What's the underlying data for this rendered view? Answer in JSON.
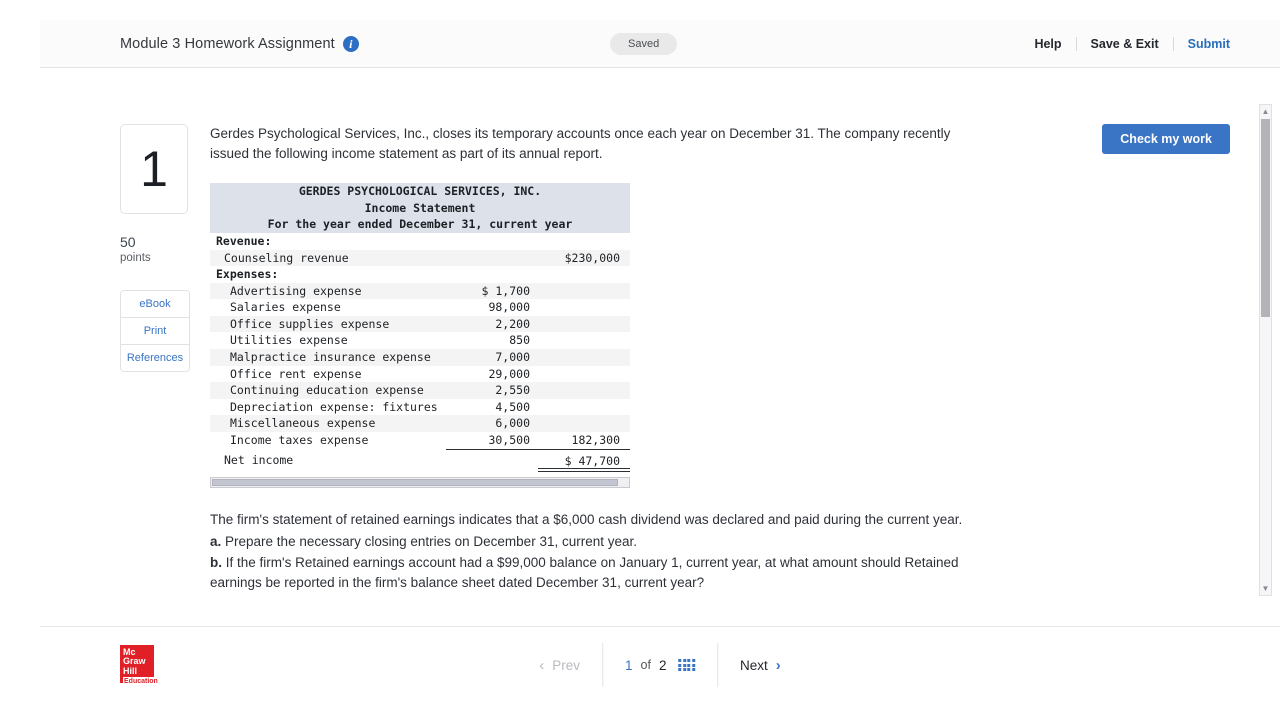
{
  "header": {
    "title": "Module 3 Homework Assignment",
    "info_icon": "info-icon",
    "saved_badge": "Saved",
    "help_label": "Help",
    "save_exit_label": "Save & Exit",
    "submit_label": "Submit"
  },
  "toolbar": {
    "check_my_work_label": "Check my work"
  },
  "rail": {
    "question_number": "1",
    "points_value": "50",
    "points_label": "points",
    "ebook_label": "eBook",
    "print_label": "Print",
    "references_label": "References"
  },
  "content": {
    "intro": "Gerdes Psychological Services, Inc., closes its temporary accounts once each year on December 31. The company recently issued the following income statement as part of its annual report.",
    "dividend_note": "The firm's statement of retained earnings indicates that a $6,000 cash dividend was declared and paid during the current year.",
    "question_a_letter": "a.",
    "question_a_text": "Prepare the necessary closing entries on December 31, current year.",
    "question_b_letter": "b.",
    "question_b_text": "If the firm's Retained earnings account had a $99,000 balance on January 1, current year, at what amount should Retained earnings be reported in the firm's balance sheet dated December 31, current year?"
  },
  "statement": {
    "title_line1": "GERDES PSYCHOLOGICAL SERVICES, INC.",
    "title_line2": "Income Statement",
    "title_line3": "For the year ended December 31, current year",
    "revenue_header": "Revenue:",
    "revenue_label": "Counseling revenue",
    "revenue_amount": "$230,000",
    "expenses_header": "Expenses:",
    "expense_rows": [
      {
        "label": "Advertising expense",
        "amount": "$ 1,700"
      },
      {
        "label": "Salaries expense",
        "amount": "98,000"
      },
      {
        "label": "Office supplies expense",
        "amount": "2,200"
      },
      {
        "label": "Utilities expense",
        "amount": "850"
      },
      {
        "label": "Malpractice insurance expense",
        "amount": "7,000"
      },
      {
        "label": "Office rent expense",
        "amount": "29,000"
      },
      {
        "label": "Continuing education expense",
        "amount": "2,550"
      },
      {
        "label": "Depreciation expense: fixtures",
        "amount": "4,500"
      },
      {
        "label": "Miscellaneous expense",
        "amount": "6,000"
      },
      {
        "label": "Income taxes expense",
        "amount": "30,500"
      }
    ],
    "total_expenses": "182,300",
    "net_income_label": "Net income",
    "net_income_amount": "$ 47,700"
  },
  "footer": {
    "logo_line1": "Mc",
    "logo_line2": "Graw",
    "logo_line3": "Hill",
    "logo_line4": "Education",
    "prev_label": "Prev",
    "current_page": "1",
    "of_label": "of",
    "total_pages": "2",
    "next_label": "Next",
    "grid_icon": "grid-menu-icon"
  },
  "colors": {
    "accent_blue": "#3a74c4",
    "link_blue": "#2a6ebb",
    "logo_red": "#e01f26",
    "statement_header_bg": "#dde1ea"
  }
}
